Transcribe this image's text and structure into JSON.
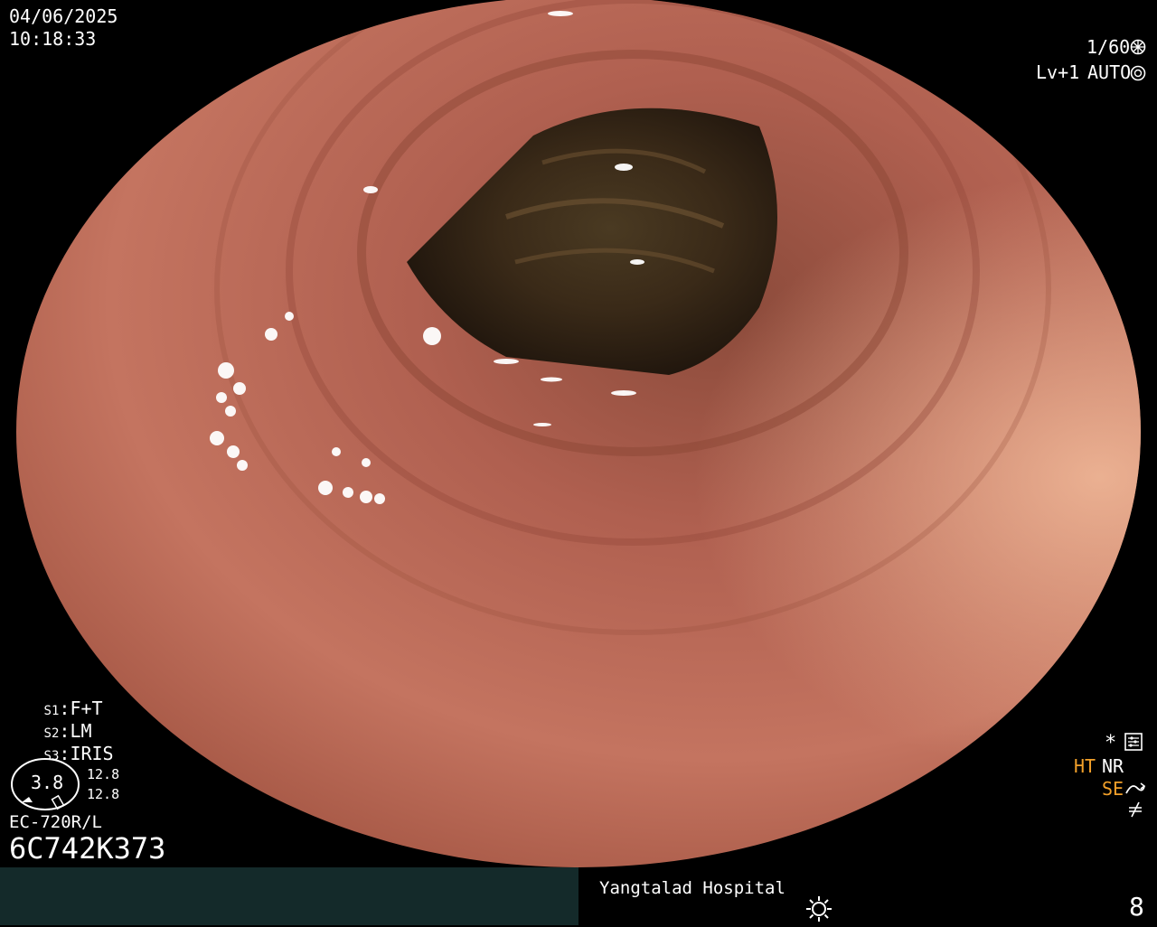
{
  "overlay": {
    "date": "04/06/2025",
    "time": "10:18:33",
    "shutter": "1/60",
    "level": "Lv+1",
    "iris_mode": "AUTO",
    "presets": [
      {
        "key": "S1",
        "value": "F+T"
      },
      {
        "key": "S2",
        "value": "LM"
      },
      {
        "key": "S3",
        "value": "IRIS"
      }
    ],
    "zoom_value": "3.8",
    "zoom_ref_1": "12.8",
    "zoom_ref_2": "12.8",
    "scope_model": "EC-720R/L",
    "scope_serial": "6C742K373",
    "right_indicators": {
      "ht": "HT",
      "nr": "NR",
      "se": "SE",
      "asterisk": "*"
    }
  },
  "footer": {
    "hospital": "Yangtalad Hospital",
    "number": "8"
  },
  "colors": {
    "mucosa": "#b4604e",
    "lumen": "#2a1d14",
    "bar_left": "#142a2a",
    "accent_orange": "#f2a02a"
  }
}
